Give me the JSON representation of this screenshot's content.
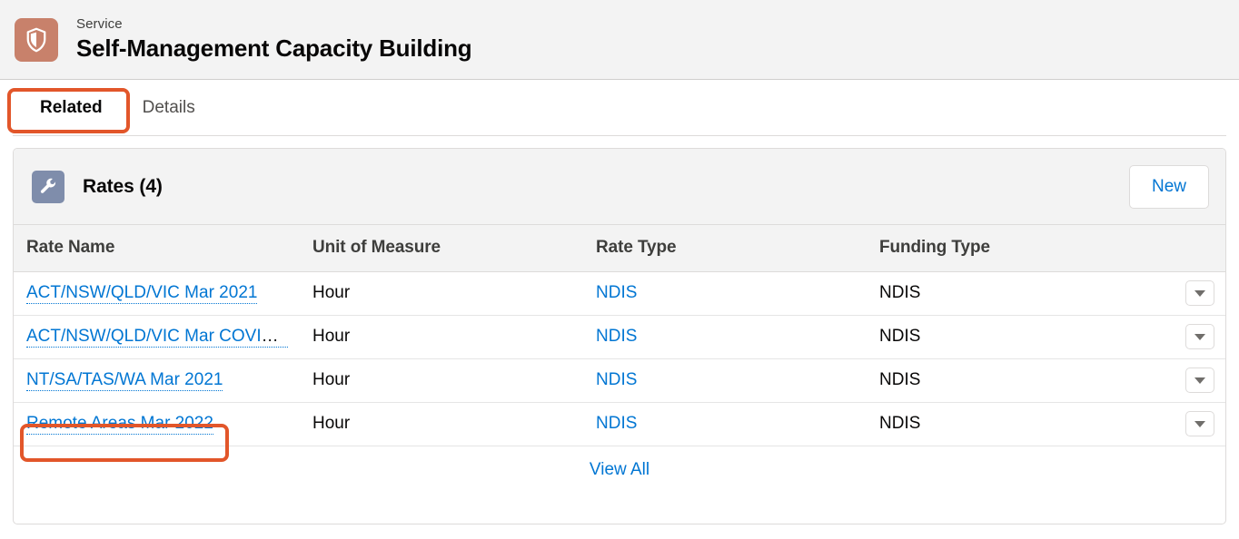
{
  "record_header": {
    "icon": "shield-icon",
    "icon_color": "#c8816b",
    "eyebrow": "Service",
    "title": "Self-Management Capacity Building"
  },
  "tabs": [
    {
      "label": "Related",
      "active": true,
      "highlighted": true
    },
    {
      "label": "Details",
      "active": false,
      "highlighted": false
    }
  ],
  "card": {
    "icon": "wrench-icon",
    "icon_color": "#7f8dab",
    "title": "Rates (4)",
    "new_button_label": "New",
    "view_all_label": "View All",
    "columns": [
      "Rate Name",
      "Unit of Measure",
      "Rate Type",
      "Funding Type"
    ],
    "rows": [
      {
        "rate_name": "ACT/NSW/QLD/VIC Mar 2021",
        "unit_of_measure": "Hour",
        "rate_type": "NDIS",
        "funding_type": "NDIS",
        "highlighted": false
      },
      {
        "rate_name": "ACT/NSW/QLD/VIC Mar COVID...",
        "unit_of_measure": "Hour",
        "rate_type": "NDIS",
        "funding_type": "NDIS",
        "highlighted": false
      },
      {
        "rate_name": "NT/SA/TAS/WA Mar 2021",
        "unit_of_measure": "Hour",
        "rate_type": "NDIS",
        "funding_type": "NDIS",
        "highlighted": false
      },
      {
        "rate_name": "Remote Areas Mar 2022",
        "unit_of_measure": "Hour",
        "rate_type": "NDIS",
        "funding_type": "NDIS",
        "highlighted": true
      }
    ],
    "row_menu_icon": "chevron-down-icon"
  },
  "annotations": {
    "color": "#e2562a",
    "targets": [
      "Related",
      "Remote Areas Mar 2022"
    ]
  }
}
